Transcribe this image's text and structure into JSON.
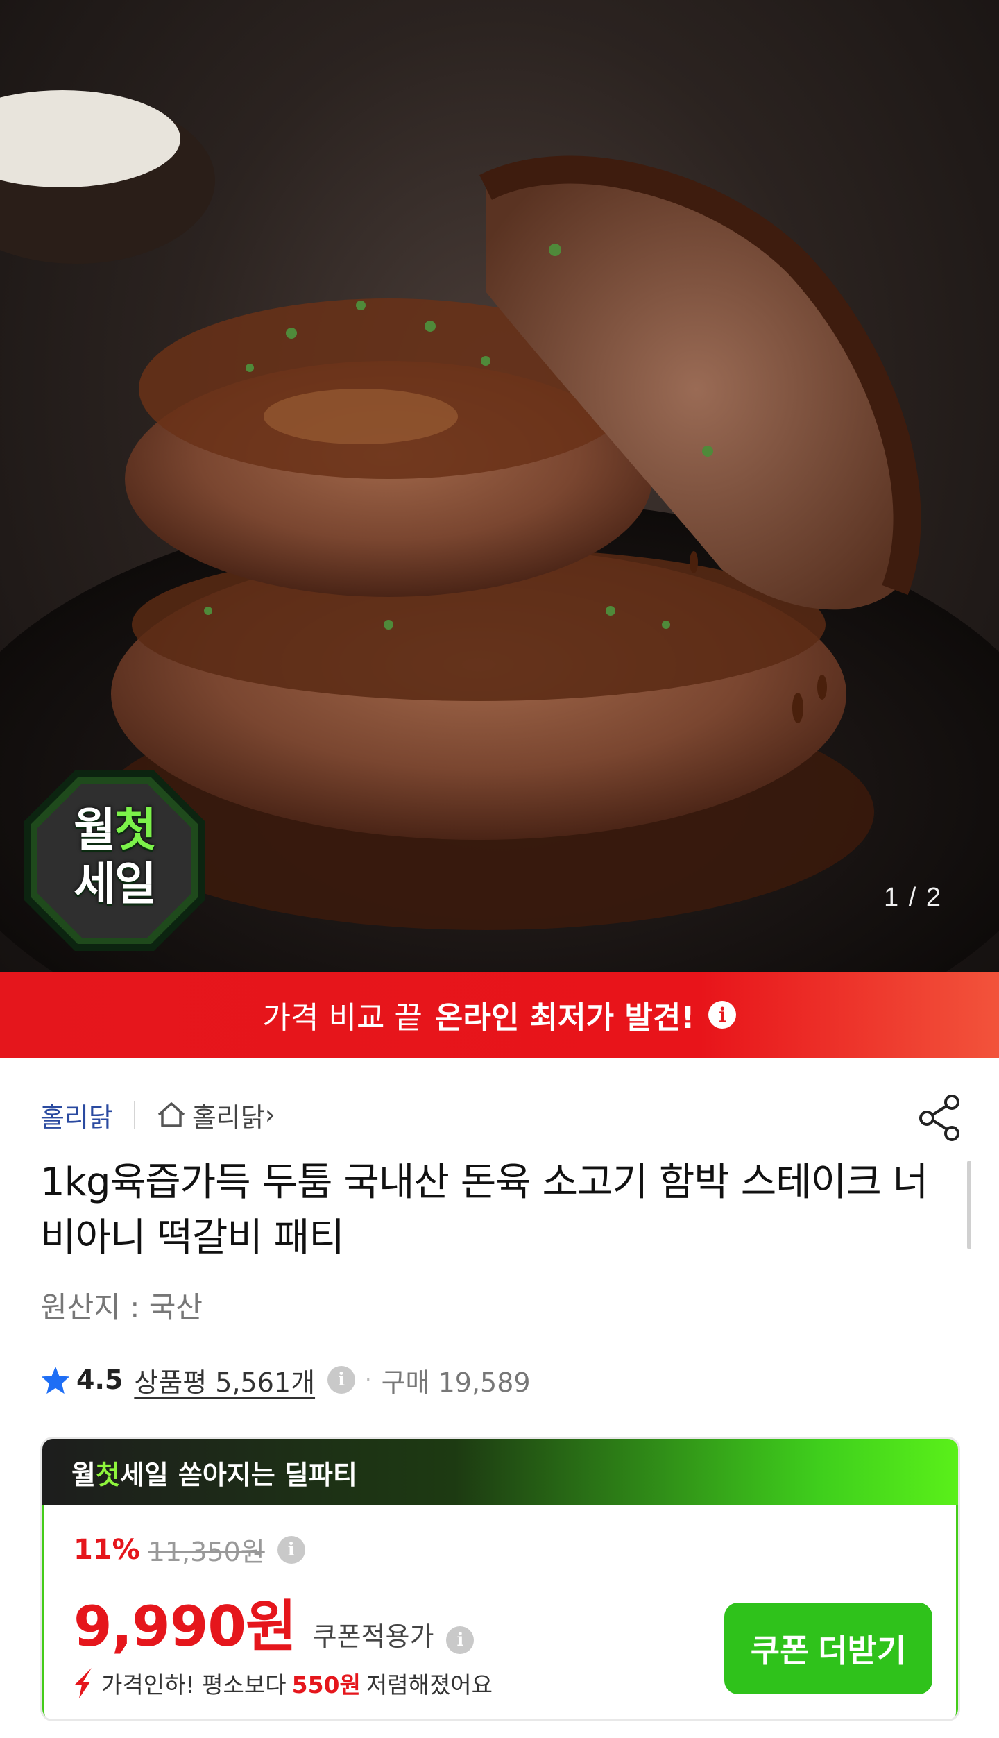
{
  "hero": {
    "image_alt": "두 장의 함박 스테이크 패티에 소스가 흘러내리는 사진",
    "badge_line1_a": "월",
    "badge_line1_b": "첫",
    "badge_line2": "세일",
    "counter": "1 / 2"
  },
  "banner": {
    "text_normal": "가격 비교 끝",
    "text_bold": "온라인 최저가 발견!",
    "info_icon": "info-circle-icon",
    "color": "#e5161c"
  },
  "store": {
    "name": "홀리닭",
    "home_label": "홀리닭",
    "home_chevron": "›"
  },
  "product": {
    "title": "1kg육즙가득 두툼 국내산 돈육 소고기 함박 스테이크 너비아니 떡갈비 패티",
    "origin": "원산지 : 국산",
    "rating": "4.5",
    "review_label": "상품평 5,561개",
    "purchase_label": "구매 19,589"
  },
  "deal": {
    "head_a": "월",
    "head_b": "첫",
    "head_c": "세일",
    "head_tail": "쏟아지는 딜파티",
    "discount_pct": "11%",
    "original_price": "11,350원",
    "sale_price": "9,990원",
    "coupon_label": "쿠폰적용가",
    "drop_prefix": "가격인하! 평소보다",
    "drop_amount": "550원",
    "drop_suffix": "저렴해졌어요",
    "coupon_button": "쿠폰 더받기",
    "accent": "#2fc21b",
    "price_color": "#e5161c"
  }
}
